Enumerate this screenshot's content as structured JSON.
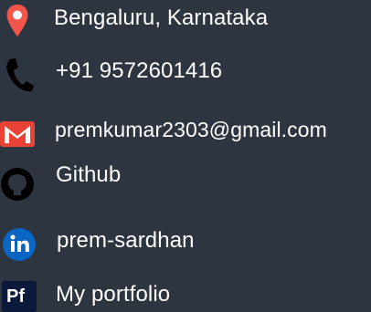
{
  "contacts": {
    "location": {
      "text": "Bengaluru, Karnataka",
      "icon": "location-pin-icon",
      "color": "#f2564b"
    },
    "phone": {
      "text": "+91 9572601416",
      "icon": "phone-icon",
      "color": "#000000"
    },
    "email": {
      "text": "premkumar2303@gmail.com",
      "icon": "gmail-icon",
      "color": "#ea4335"
    },
    "github": {
      "text": "Github",
      "icon": "github-icon",
      "color": "#000000"
    },
    "linkedin": {
      "text": "prem-sardhan",
      "icon": "linkedin-icon",
      "color": "#0a66c2"
    },
    "portfolio": {
      "text": "My portfolio",
      "icon": "portfolio-pf-icon",
      "badge": "Pf",
      "color": "#0b1a3a"
    }
  }
}
